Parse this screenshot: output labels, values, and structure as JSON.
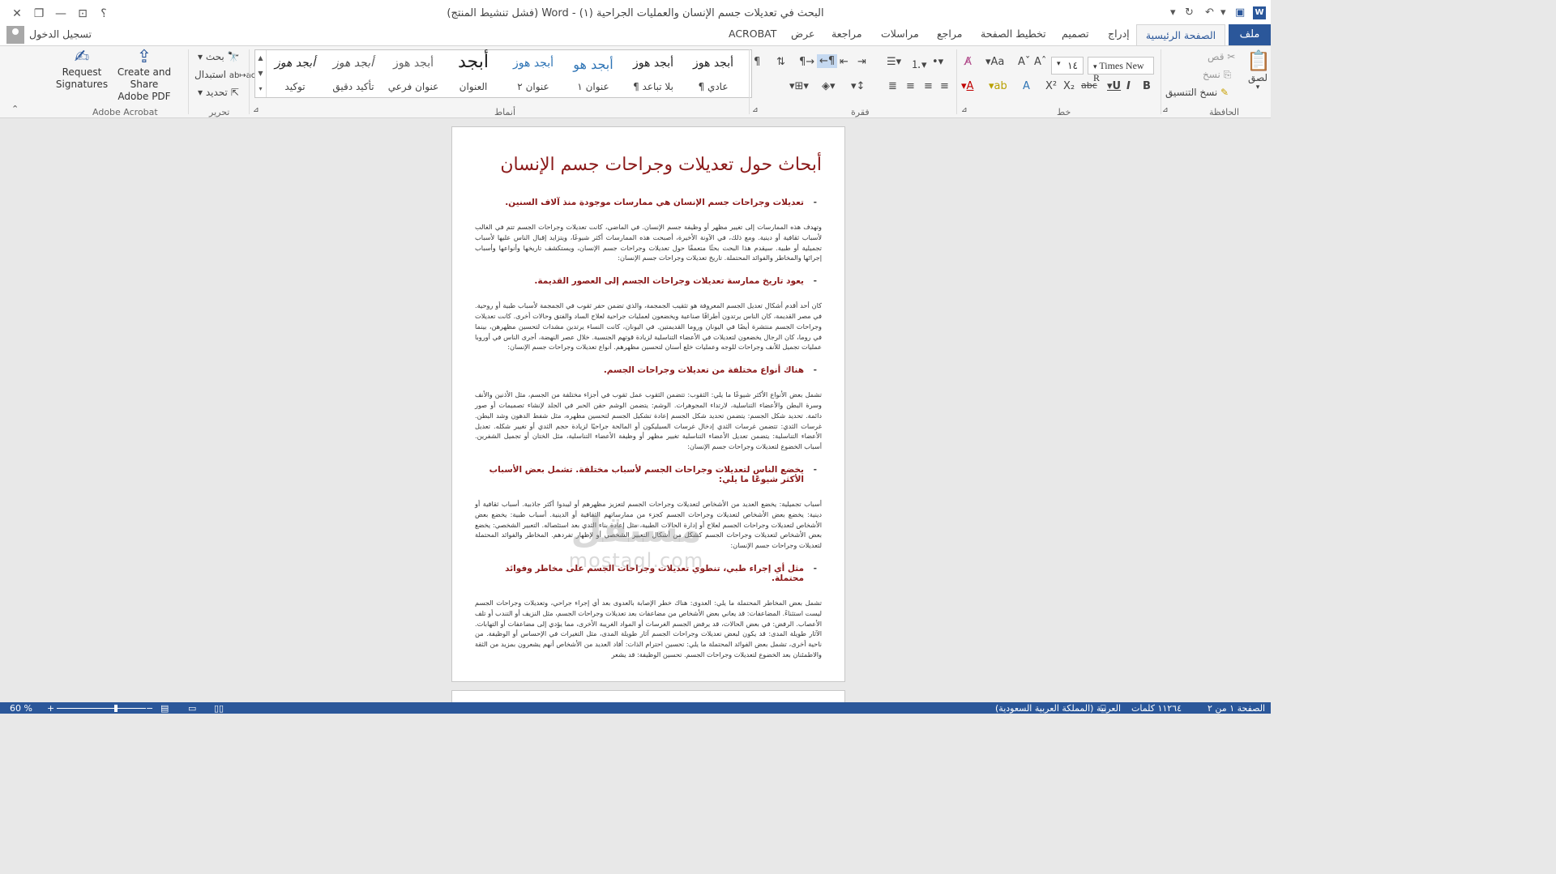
{
  "window": {
    "title": "البحث في تعديلات جسم الإنسان والعمليات الجراحية (١) - Word (فشل تنشيط المنتج)",
    "help_label": "؟"
  },
  "tabs": {
    "file": "ملف",
    "home": "الصفحة الرئيسية",
    "insert": "إدراج",
    "design": "تصميم",
    "layout": "تخطيط الصفحة",
    "references": "مراجع",
    "mailings": "مراسلات",
    "review": "مراجعة",
    "view": "عرض",
    "acrobat": "ACROBAT",
    "sign_in": "تسجيل الدخول"
  },
  "ribbon": {
    "clipboard": {
      "label": "الحافظة",
      "paste": "لصق",
      "cut": "قص",
      "copy": "نسخ",
      "format_painter": "نسخ التنسيق"
    },
    "font": {
      "label": "خط",
      "name": "Times New R",
      "size": "١٤"
    },
    "paragraph": {
      "label": "فقرة"
    },
    "styles": {
      "label": "أنماط",
      "items": [
        {
          "sample": "أبجد هوز",
          "name": "¶ عادي"
        },
        {
          "sample": "أبجد هوز",
          "name": "¶ بلا تباعد"
        },
        {
          "sample": "أبجد هو",
          "name": "عنوان ١"
        },
        {
          "sample": "أبجد هوز",
          "name": "عنوان ٢"
        },
        {
          "sample": "أبجد",
          "name": "العنوان"
        },
        {
          "sample": "أبجد هوز",
          "name": "عنوان فرعي"
        },
        {
          "sample": "أبجد هوز",
          "name": "تأكيد دقيق"
        },
        {
          "sample": "أبجد هوز",
          "name": "توكيد"
        }
      ]
    },
    "editing": {
      "label": "تحرير",
      "find": "بحث",
      "replace": "استبدال",
      "select": "تحديد"
    },
    "acrobat": {
      "label": "Adobe Acrobat",
      "request_line1": "Request",
      "request_line2": "Signatures",
      "share_line1": "Create and",
      "share_line2": "Share Adobe PDF"
    }
  },
  "document": {
    "heading": "أبحاث حول تعديلات وجراحات جسم الإنسان",
    "sections": [
      {
        "head": "تعديلات وجراحات جسم الإنسان هي ممارسات موجودة منذ آلاف السنين.",
        "body": "وتهدف هذه الممارسات إلى تغيير مظهر أو وظيفة جسم الإنسان. في الماضي، كانت تعديلات وجراحات الجسم تتم في الغالب لأسباب ثقافية أو دينية. ومع ذلك، في الآونة الأخيرة، أصبحت هذه الممارسات أكثر شيوعًا، ويتزايد إقبال الناس عليها لأسباب تجميلية أو طبية. سيقدم هذا البحث بحثًا متعمقًا حول تعديلات وجراحات جسم الإنسان، ويستكشف تاريخها وأنواعها وأسباب إجرائها والمخاطر والفوائد المحتملة. تاريخ تعديلات وجراحات جسم الإنسان:"
      },
      {
        "head": "يعود تاريخ ممارسة تعديلات وجراحات الجسم إلى العصور القديمة.",
        "body": "كان أحد أقدم أشكال تعديل الجسم المعروفة هو تثقيب الجمجمة، والذي تضمن حفر ثقوب في الجمجمة لأسباب طبية أو روحية. في مصر القديمة، كان الناس يرتدون أطرافًا صناعية ويخضعون لعمليات جراحية لعلاج الساد والفتق وحالات أخرى. كانت تعديلات وجراحات الجسم منتشرة أيضًا في اليونان وروما القديمتين. في اليونان، كانت النساء يرتدين مشدات لتحسين مظهرهن، بينما في روما، كان الرجال يخضعون لتعديلات في الأعضاء التناسلية لزيادة قوتهم الجنسية. خلال عصر النهضة، أجرى الناس في أوروبا عمليات تجميل للأنف وجراحات للوجه وعمليات خلع أسنان لتحسين مظهرهم. أنواع تعديلات وجراحات جسم الإنسان:"
      },
      {
        "head": "هناك أنواع مختلفة من تعديلات وجراحات الجسم.",
        "body": "تشمل بعض الأنواع الأكثر شيوعًا ما يلي: الثقوب: تتضمن الثقوب عمل ثقوب في أجزاء مختلفة من الجسم، مثل الأذنين والأنف وسرة البطن والأعضاء التناسلية، لارتداء المجوهرات. الوشم: يتضمن الوشم حقن الحبر في الجلد لإنشاء تصميمات أو صور دائمة. تحديد شكل الجسم: يتضمن تحديد شكل الجسم إعادة تشكيل الجسم لتحسين مظهره، مثل شفط الدهون وشد البطن. غرسات الثدي: تتضمن غرسات الثدي إدخال غرسات السيليكون أو المالحة جراحيًا لزيادة حجم الثدي أو تغيير شكله. تعديل الأعضاء التناسلية: يتضمن تعديل الأعضاء التناسلية تغيير مظهر أو وظيفة الأعضاء التناسلية، مثل الختان أو تجميل الشفرين. أسباب الخضوع لتعديلات وجراحات جسم الإنسان:"
      },
      {
        "head": "يخضع الناس لتعديلات وجراحات الجسم لأسباب مختلفة. تشمل بعض الأسباب الأكثر شيوعًا ما يلي:",
        "body": "أسباب تجميلية: يخضع العديد من الأشخاص لتعديلات وجراحات الجسم لتعزيز مظهرهم أو ليبدوا أكثر جاذبية. أسباب ثقافية أو دينية: يخضع بعض الأشخاص لتعديلات وجراحات الجسم كجزء من ممارساتهم الثقافية أو الدينية. أسباب طبية: يخضع بعض الأشخاص لتعديلات وجراحات الجسم لعلاج أو إدارة الحالات الطبية، مثل إعادة بناء الثدي بعد استئصاله. التعبير الشخصي: يخضع بعض الأشخاص لتعديلات وجراحات الجسم كشكل من أشكال التعبير الشخصي أو لإظهار تفردهم. المخاطر والفوائد المحتملة لتعديلات وجراحات جسم الإنسان:"
      },
      {
        "head": "مثل أي إجراء طبي، تنطوي تعديلات وجراحات الجسم على مخاطر وفوائد محتملة.",
        "body": "تشمل بعض المخاطر المحتملة ما يلي: العدوى: هناك خطر الإصابة بالعدوى بعد أي إجراء جراحي، وتعديلات وجراحات الجسم ليست استثناءً. المضاعفات: قد يعاني بعض الأشخاص من مضاعفات بعد تعديلات وجراحات الجسم، مثل النزيف أو التندب أو تلف الأعصاب. الرفض: في بعض الحالات، قد يرفض الجسم الغرسات أو المواد الغريبة الأخرى، مما يؤدي إلى مضاعفات أو التهابات. الآثار طويلة المدى: قد يكون لبعض تعديلات وجراحات الجسم آثار طويلة المدى، مثل التغيرات في الإحساس أو الوظيفة. من ناحية أخرى، تشمل بعض الفوائد المحتملة ما يلي: تحسين احترام الذات: أفاد العديد من الأشخاص أنهم يشعرون بمزيد من الثقة والاطمئنان بعد الخضوع لتعديلات وجراحات الجسم. تحسين الوظيفة: قد يشعر"
      }
    ]
  },
  "watermark": {
    "arabic": "مستقل",
    "latin": "mostaql.com"
  },
  "status": {
    "page": "الصفحة ١ من ٢",
    "words": "١١٢٦٤ كلمات",
    "language": "العربية (المملكة العربية السعودية)",
    "zoom": "60 %",
    "zoom_level": 0.6
  }
}
